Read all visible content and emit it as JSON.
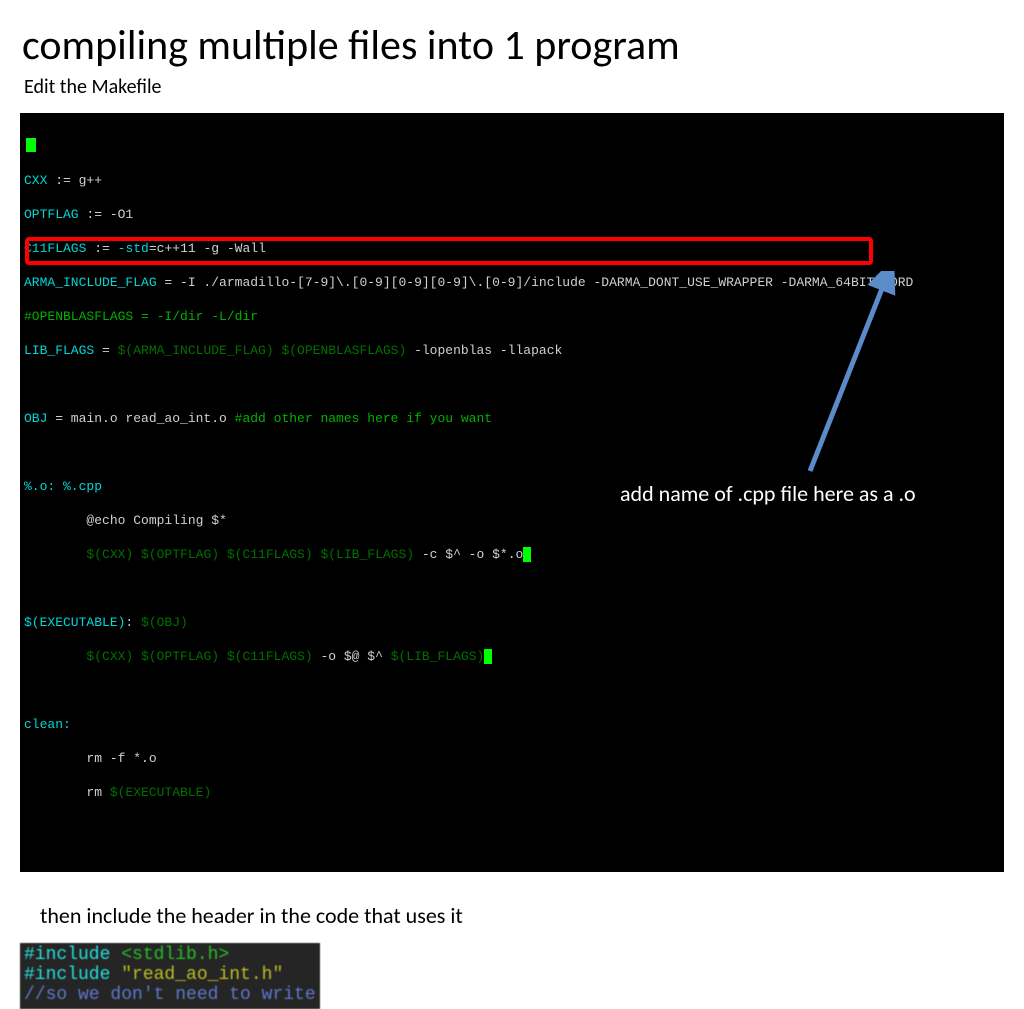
{
  "title": "compiling multiple files into 1 program",
  "subtitle": "Edit the Makefile",
  "makefile": {
    "l1a": "CXX",
    "l1b": " := g++",
    "l2a": "OPTFLAG",
    "l2b": " := -O1",
    "l3a": "C11FLAGS",
    "l3b": " := ",
    "l3c": "-std",
    "l3d": "=c++11 -g -Wall",
    "l4a": "ARMA_INCLUDE_FLAG",
    "l4b": " = -I ./armadillo-[7-9]\\.[0-9][0-9][0-9]\\.[0-9]/include -DARMA_DONT_USE_WRAPPER -DARMA_64BIT_WORD",
    "l5": "#OPENBLASFLAGS = -I/dir -L/dir",
    "l6a": "LIB_FLAGS",
    "l6b": " = ",
    "l6c": "$(ARMA_INCLUDE_FLAG) $(OPENBLASFLAGS)",
    "l6d": " -lopenblas -llapack",
    "l8a": "OBJ",
    "l8b": " = main.o read_ao_int.o ",
    "l8c": "#add other names here if you want",
    "l10": "%.o: %.cpp",
    "l11": "        @echo Compiling $*",
    "l12a": "        ",
    "l12b": "$(CXX) $(OPTFLAG) $(C11FLAGS) $(LIB_FLAGS)",
    "l12c": " -c $^ -o $*.o",
    "l14a": "$(EXECUTABLE)",
    "l14b": ": ",
    "l14c": "$(OBJ)",
    "l15a": "        ",
    "l15b": "$(CXX) $(OPTFLAG) $(C11FLAGS)",
    "l15c": " -o $@ $^ ",
    "l15d": "$(LIB_FLAGS)",
    "l17": "clean:",
    "l18": "        rm -f *.o",
    "l19a": "        rm ",
    "l19b": "$(EXECUTABLE)"
  },
  "annotation": "add name of .cpp file here as a .o",
  "note2": "then include the header in the code that uses it",
  "inc": {
    "l1a": "#include ",
    "l1b": "<stdlib.h>",
    "l2a": "#include ",
    "l2b": "\"read_ao_int.h\"",
    "l3": "//so we don't need to write"
  }
}
